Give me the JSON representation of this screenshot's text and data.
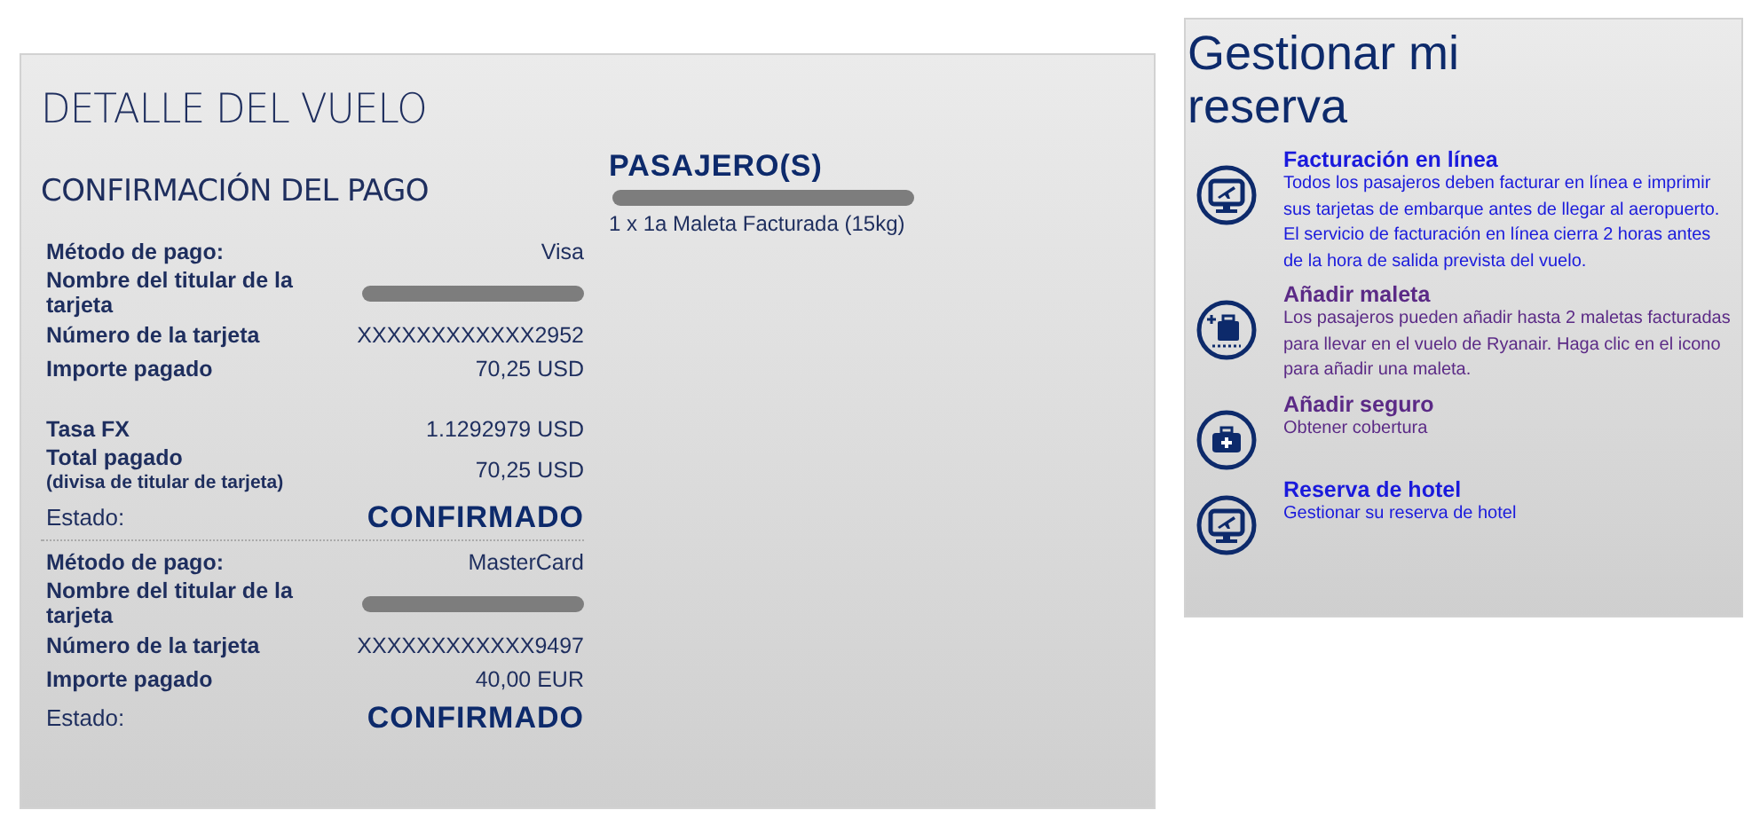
{
  "flight_detail": {
    "title": "DETALLE DEL VUELO",
    "payment": {
      "heading": "CONFIRMACIÓN DEL PAGO",
      "blocks": [
        {
          "rows": [
            {
              "kind": "text",
              "label": "Método de pago:",
              "value": "Visa"
            },
            {
              "kind": "redacted",
              "label": "Nombre del titular de la tarjeta"
            },
            {
              "kind": "text",
              "label": "Número de la tarjeta",
              "value": "XXXXXXXXXXXX2952"
            },
            {
              "kind": "text",
              "label": "Importe pagado",
              "value": "70,25 USD"
            },
            {
              "kind": "gap"
            },
            {
              "kind": "text",
              "label": "Tasa FX",
              "value": "1.1292979 USD"
            },
            {
              "kind": "total",
              "label": "Total pagado",
              "sublabel": "(divisa de titular de tarjeta)",
              "value": "70,25 USD"
            },
            {
              "kind": "status",
              "label": "Estado:",
              "value": "CONFIRMADO"
            }
          ]
        },
        {
          "rows": [
            {
              "kind": "text",
              "label": "Método de pago:",
              "value": "MasterCard"
            },
            {
              "kind": "redacted",
              "label": "Nombre del titular de la tarjeta"
            },
            {
              "kind": "text",
              "label": "Número de la tarjeta",
              "value": "XXXXXXXXXXXX9497"
            },
            {
              "kind": "text",
              "label": "Importe pagado",
              "value": "40,00 EUR"
            },
            {
              "kind": "status",
              "label": "Estado:",
              "value": "CONFIRMADO"
            }
          ]
        }
      ]
    },
    "passengers": {
      "heading": "PASAJERO(S)",
      "name_redacted": true,
      "items": [
        "1 x 1a Maleta Facturada (15kg)"
      ]
    }
  },
  "manage_booking": {
    "title": "Gestionar mi reserva",
    "items": [
      {
        "kind": "monitor",
        "title": "Facturación en línea",
        "visited": false,
        "text": "Todos los pasajeros deben facturar en línea e imprimir sus tarjetas de embarque antes de llegar al aeropuerto. El servicio de facturación en línea cierra 2 horas antes de la hora de salida prevista del vuelo."
      },
      {
        "kind": "bag",
        "title": "Añadir maleta",
        "visited": true,
        "text": "Los pasajeros pueden añadir hasta 2 maletas facturadas para llevar en el vuelo de Ryanair. Haga clic en el icono para añadir una maleta."
      },
      {
        "kind": "medkit",
        "title": "Añadir seguro",
        "visited": true,
        "text": "Obtener cobertura"
      },
      {
        "kind": "monitor",
        "title": "Reserva de hotel",
        "visited": false,
        "text": "Gestionar su reserva de hotel"
      }
    ]
  }
}
